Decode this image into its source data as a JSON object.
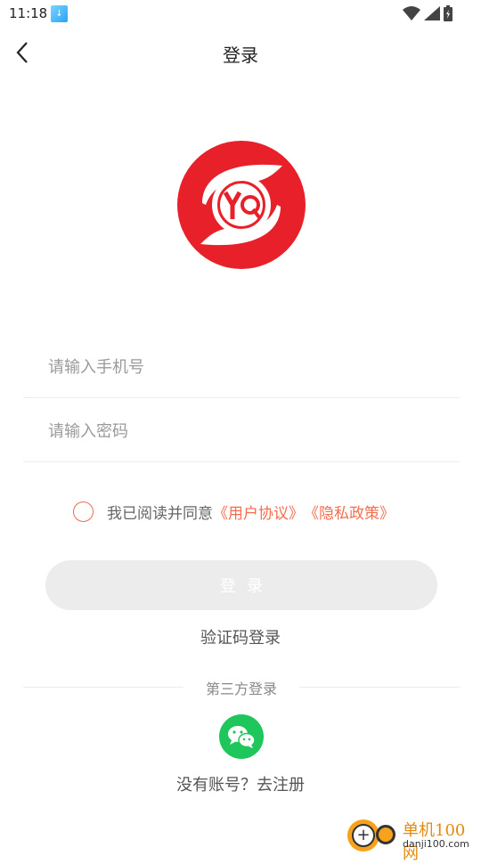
{
  "status_bar": {
    "time": "11:18"
  },
  "nav": {
    "title": "登录"
  },
  "form": {
    "phone_placeholder": "请输入手机号",
    "password_placeholder": "请输入密码"
  },
  "agreement": {
    "prefix": "我已阅读并同意",
    "user_agreement": "《用户协议》",
    "privacy_policy": "《隐私政策》"
  },
  "login_button": "登录",
  "sms_login": "验证码登录",
  "third_party_label": "第三方登录",
  "register_link": "没有账号？去注册",
  "watermark": {
    "title": "单机100网",
    "subtitle": "danji100.com"
  },
  "colors": {
    "accent": "#f36d4f",
    "logo_red": "#e8202a",
    "wechat_green": "#1ec65b",
    "button_disabled": "#ececec"
  }
}
